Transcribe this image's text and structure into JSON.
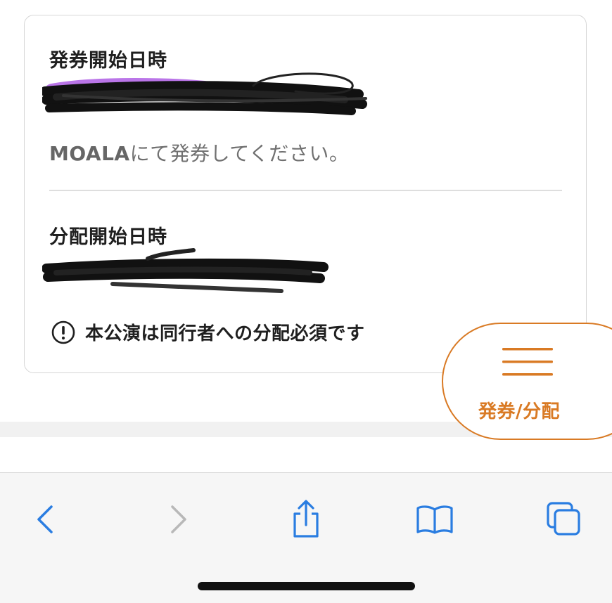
{
  "issue_section": {
    "title": "発券開始日時",
    "note_brand": "MOALA",
    "note_text": "にて発券してください。"
  },
  "distribution_section": {
    "title": "分配開始日時",
    "alert_text": "本公演は同行者への分配必須です"
  },
  "fab": {
    "label": "発券/分配",
    "icon": "hamburger-menu-icon"
  },
  "toolbar": {
    "buttons": [
      "back-icon",
      "forward-icon",
      "share-icon",
      "bookmarks-icon",
      "tabs-icon"
    ]
  },
  "colors": {
    "accent": "#d97a24",
    "ios_blue": "#2a7de1",
    "disabled": "#b8b8b8",
    "redaction": "#111111",
    "redaction_highlight": "#b266e6"
  }
}
